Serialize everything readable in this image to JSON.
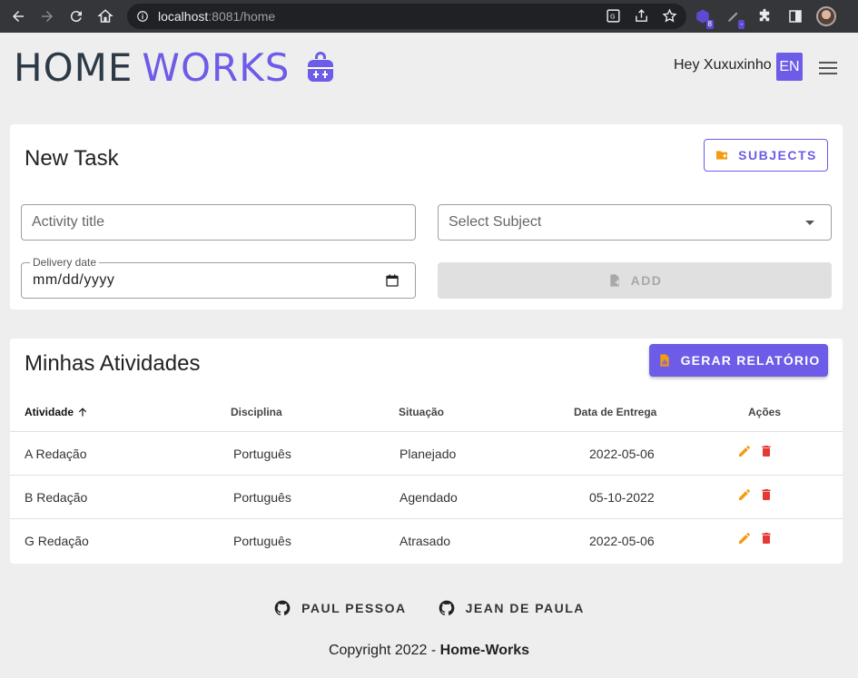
{
  "browser": {
    "url_host": "localhost",
    "url_path": ":8081/home",
    "ext_badge_1": "8",
    "ext_badge_2": "-"
  },
  "header": {
    "logo_home": "HOME",
    "logo_works": "WORKS",
    "greeting": "Hey Xuxuxinho",
    "lang": "EN"
  },
  "new_task": {
    "title": "New Task",
    "subjects_button": "SUBJECTS",
    "activity_placeholder": "Activity title",
    "subject_placeholder": "Select Subject",
    "date_label": "Delivery date",
    "date_value": "mm/dd/yyyy",
    "add_button": "ADD"
  },
  "activities": {
    "title": "Minhas Atividades",
    "report_button": "GERAR RELATÓRIO",
    "columns": {
      "atividade": "Atividade",
      "disciplina": "Disciplina",
      "situacao": "Situação",
      "data": "Data de Entrega",
      "acoes": "Ações"
    },
    "rows": [
      {
        "atividade": "A Redação",
        "disciplina": "Português",
        "situacao": "Planejado",
        "data": "2022-05-06"
      },
      {
        "atividade": "B Redação",
        "disciplina": "Português",
        "situacao": "Agendado",
        "data": "05-10-2022"
      },
      {
        "atividade": "G Redação",
        "disciplina": "Português",
        "situacao": "Atrasado",
        "data": "2022-05-06"
      }
    ]
  },
  "footer": {
    "link1": "PAUL PESSOA",
    "link2": "JEAN DE PAULA",
    "copyright_prefix": "Copyright 2022 - ",
    "copyright_brand": "Home-Works"
  },
  "colors": {
    "accent": "#6c5ce7",
    "edit_icon": "#f39c12",
    "delete_icon": "#e53935"
  }
}
